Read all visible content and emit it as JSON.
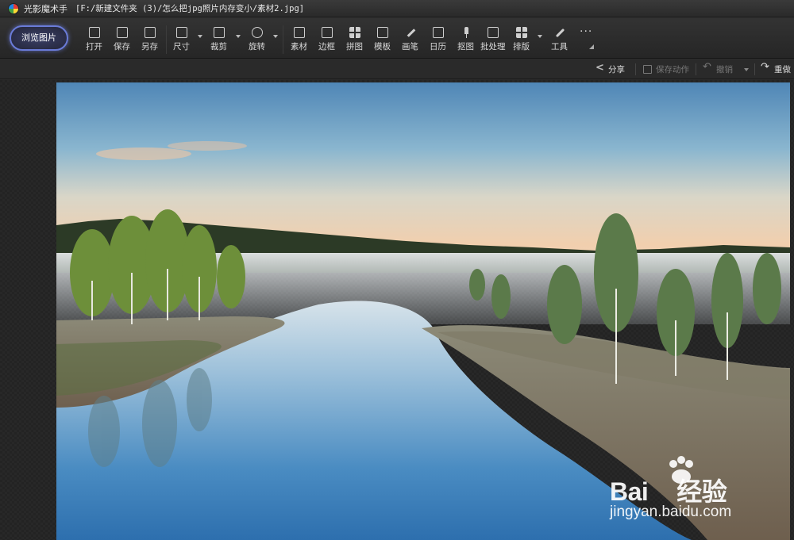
{
  "window": {
    "app_name": "光影魔术手",
    "file_path": "[F:/新建文件夹 (3)/怎么把jpg照片内存变小/素材2.jpg]"
  },
  "toolbar": {
    "browse_label": "浏览图片",
    "tools": [
      {
        "label": "打开",
        "icon": "open-image-icon"
      },
      {
        "label": "保存",
        "icon": "save-icon"
      },
      {
        "label": "另存",
        "icon": "save-as-icon"
      },
      {
        "label": "尺寸",
        "icon": "resize-icon"
      },
      {
        "label": "裁剪",
        "icon": "crop-icon"
      },
      {
        "label": "旋转",
        "icon": "rotate-icon"
      },
      {
        "label": "素材",
        "icon": "sticker-icon"
      },
      {
        "label": "边框",
        "icon": "frame-icon"
      },
      {
        "label": "拼图",
        "icon": "collage-icon"
      },
      {
        "label": "模板",
        "icon": "template-icon"
      },
      {
        "label": "画笔",
        "icon": "brush-icon"
      },
      {
        "label": "日历",
        "icon": "calendar-icon"
      },
      {
        "label": "抠图",
        "icon": "cutout-icon"
      },
      {
        "label": "批处理",
        "icon": "batch-icon"
      },
      {
        "label": "排版",
        "icon": "layout-icon"
      },
      {
        "label": "工具",
        "icon": "wrench-icon"
      }
    ],
    "more": "···"
  },
  "subbar": {
    "share": "分享",
    "save_action": "保存动作",
    "undo": "撤销",
    "redo": "重做"
  },
  "watermark": {
    "brand": "Bai",
    "brand_cn": "经验",
    "url": "jingyan.baidu.com"
  },
  "colors": {
    "accent": "#6a7bd8",
    "toolbar_bg": "#2e2e2e"
  }
}
